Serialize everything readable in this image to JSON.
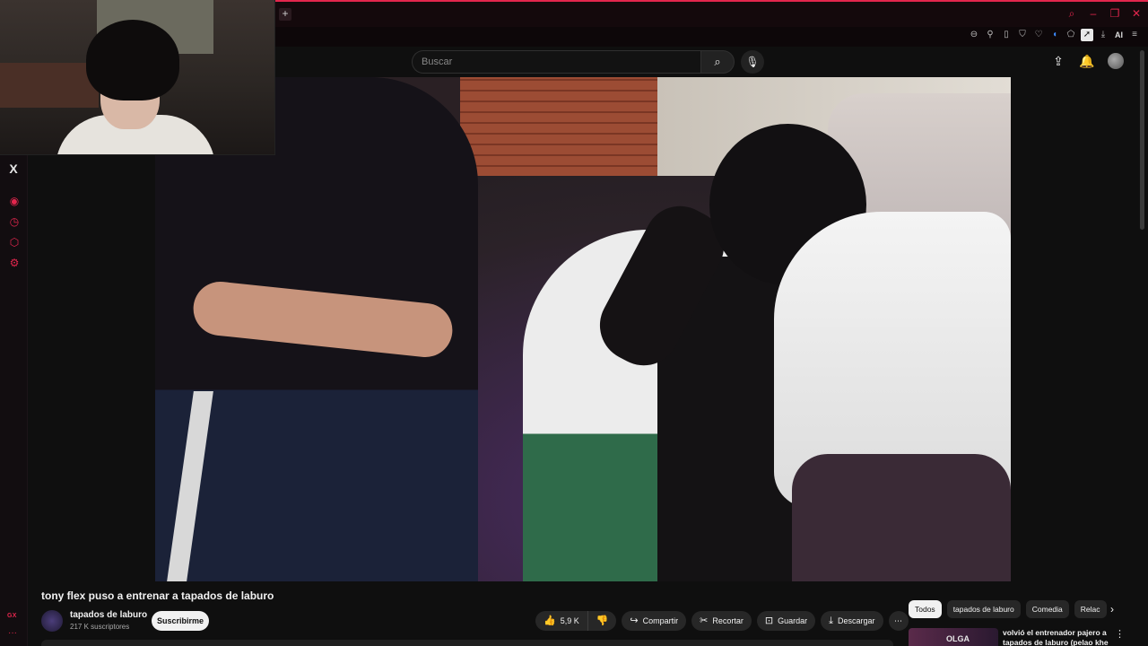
{
  "browser": {
    "new_tab_symbol": "+",
    "sidebar_logo": "X",
    "sidebar_brand": "GX",
    "sidebar_more": "···",
    "extensions_ai_label": "AI",
    "accent_color": "#e2264d"
  },
  "masthead": {
    "search_placeholder": "Buscar"
  },
  "video": {
    "title": "tony flex puso a entrenar a tapados de laburo"
  },
  "channel": {
    "name": "tapados de laburo",
    "subscribers": "217 K suscriptores",
    "subscribe_label": "Suscribirme"
  },
  "actions": {
    "likes": "5,9 K",
    "share": "Compartir",
    "clip": "Recortar",
    "save": "Guardar",
    "download": "Descargar"
  },
  "chips": [
    {
      "label": "Todos",
      "active": true
    },
    {
      "label": "tapados de laburo",
      "active": false
    },
    {
      "label": "Comedia",
      "active": false
    },
    {
      "label": "Relac",
      "active": false
    }
  ],
  "recommendation": {
    "thumb_text": "OLGA",
    "title": "volvió el entrenador pajero a tapados de laburo (pelao khe"
  }
}
